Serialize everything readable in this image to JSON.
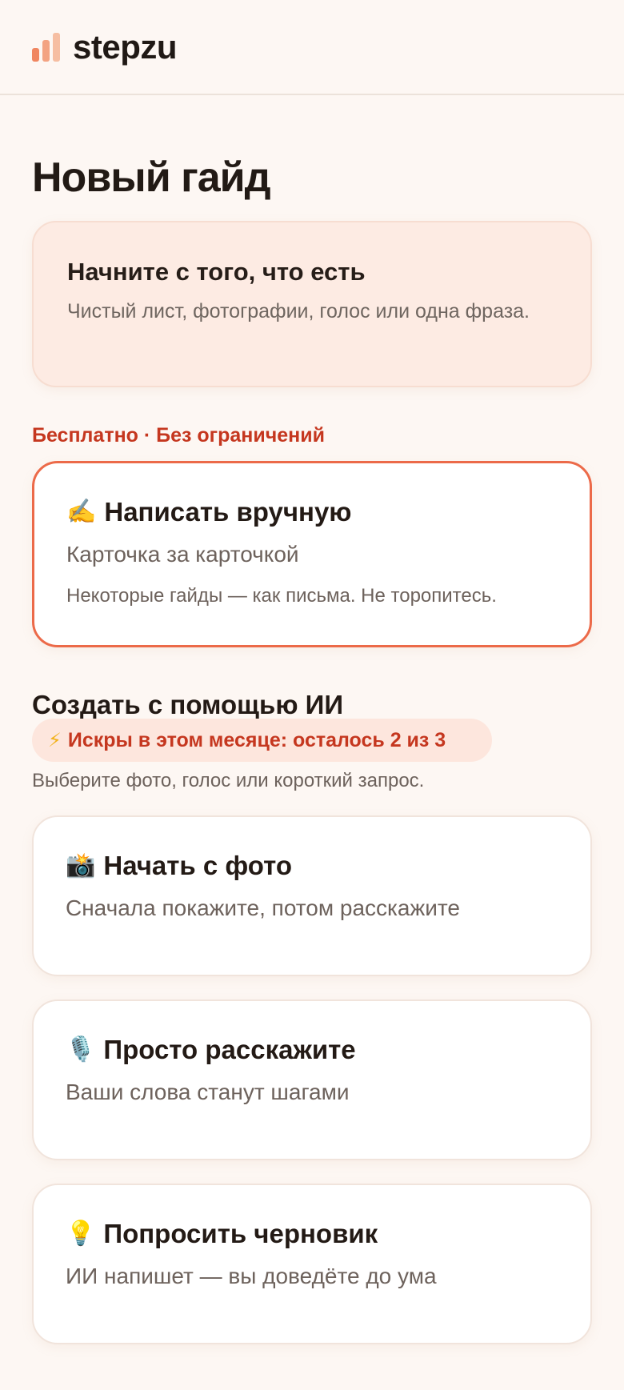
{
  "header": {
    "logo_text": "stepzu"
  },
  "page_title": "Новый гайд",
  "intro": {
    "title": "Начните с того, что есть",
    "description": "Чистый лист, фотографии, голос или одна фраза."
  },
  "free_label": "Бесплатно · Без ограничений",
  "manual_card": {
    "emoji": "✍️",
    "icon": "writing-hand-icon",
    "title": "Написать вручную",
    "subtitle": "Карточка за карточкой",
    "note": "Некоторые гайды — как письма. Не торопитесь."
  },
  "ai_section": {
    "title": "Создать с помощью ИИ",
    "spark_icon": "⚡",
    "spark_text": "Искры в этом месяце: осталось 2 из 3",
    "hint": "Выберите фото, голос или короткий запрос."
  },
  "ai_options": [
    {
      "emoji": "📸",
      "icon": "camera-flash-icon",
      "title": "Начать с фото",
      "subtitle": "Сначала покажите, потом расскажите"
    },
    {
      "emoji": "🎙️",
      "icon": "microphone-icon",
      "title": "Просто расскажите",
      "subtitle": "Ваши слова станут шагами"
    },
    {
      "emoji": "💡",
      "icon": "light-bulb-icon",
      "title": "Попросить черновик",
      "subtitle": "ИИ напишет — вы доведёте до ума"
    }
  ],
  "colors": {
    "background": "#fdf7f3",
    "accent": "#ec6a49",
    "accent_text": "#c5371f",
    "intro_bg": "#fdebe3"
  }
}
